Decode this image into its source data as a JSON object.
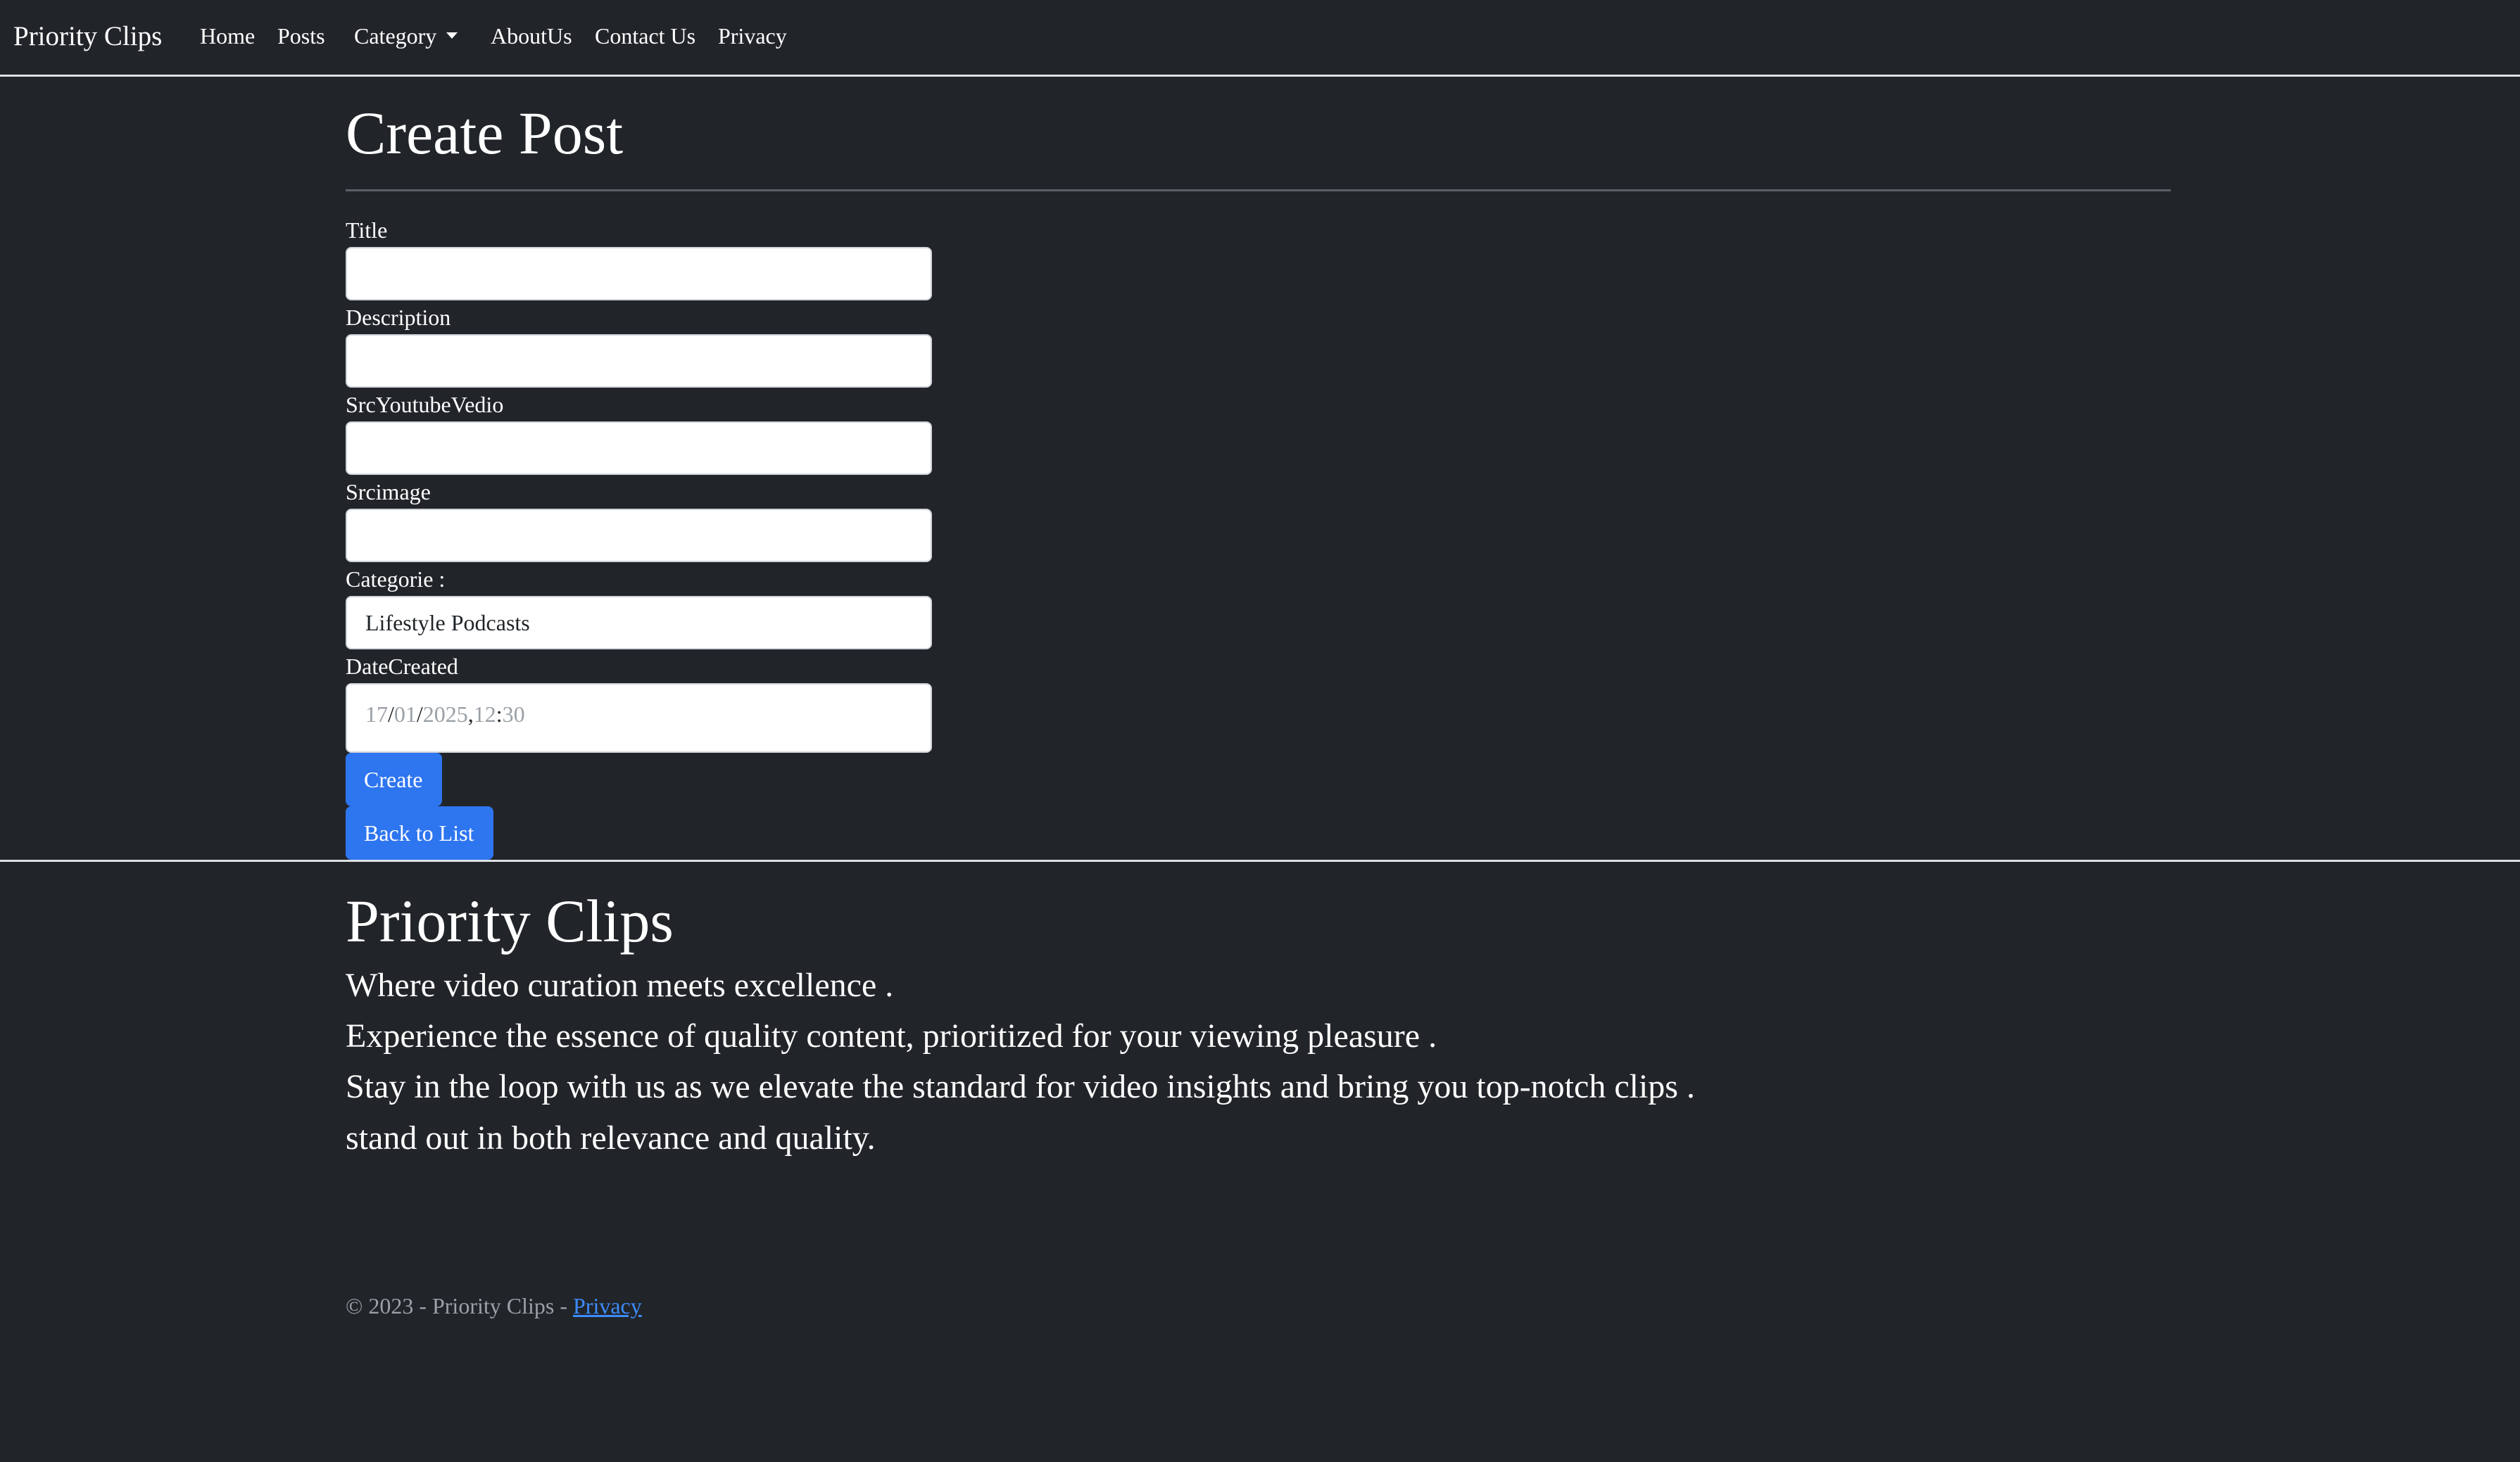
{
  "navbar": {
    "brand": "Priority Clips",
    "items": {
      "home": "Home",
      "posts": "Posts",
      "category": "Category",
      "about": "AboutUs",
      "contact": "Contact Us",
      "privacy": "Privacy"
    }
  },
  "page": {
    "title": "Create Post"
  },
  "form": {
    "title_label": "Title",
    "title_value": "",
    "description_label": "Description",
    "description_value": "",
    "youtube_label": "SrcYoutubeVedio",
    "youtube_value": "",
    "image_label": "Srcimage",
    "image_value": "",
    "category_label": "Categorie :",
    "category_selected": "Lifestyle Podcasts",
    "date_label": "DateCreated",
    "date": {
      "day": "17",
      "month": "01",
      "year": "2025",
      "hour": "12",
      "minute": "30"
    },
    "create_button": "Create",
    "back_button": "Back to List"
  },
  "footer": {
    "brand": "Priority Clips",
    "lines": [
      "Where video curation meets excellence .",
      "Experience the essence of quality content, prioritized for your viewing pleasure .",
      "Stay in the loop with us as we elevate the standard for video insights and bring you top-notch clips .",
      "stand out in both relevance and quality."
    ],
    "copyright": "© 2023 - Priority Clips - ",
    "privacy_link": "Privacy"
  },
  "colors": {
    "background": "#212529",
    "primary_button": "#2e75f0",
    "link": "#3d8bfd",
    "muted_text": "#9ba1a8"
  }
}
